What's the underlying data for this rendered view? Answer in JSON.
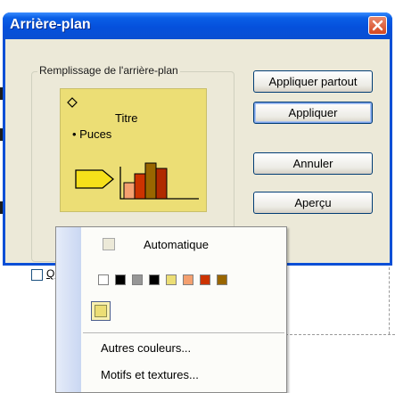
{
  "dialog": {
    "title": "Arrière-plan",
    "group_label": "Remplissage de l'arrière-plan",
    "preview": {
      "title_text": "Titre",
      "bullet_text": "Puces"
    },
    "combo": {
      "selected_color": "#ecde75"
    },
    "checkbox": {
      "label": "Q",
      "checked": false
    }
  },
  "buttons": {
    "apply_all": "Appliquer partout",
    "apply": "Appliquer",
    "cancel": "Annuler",
    "preview": "Aperçu"
  },
  "popup": {
    "automatic_label": "Automatique",
    "scheme_colors": [
      "#ffffff",
      "#000000",
      "#969696",
      "#000000",
      "#ecde75",
      "#f4a070",
      "#cc3300",
      "#996600"
    ],
    "recent_color": "#ecde75",
    "more_colors_label": "Autres couleurs...",
    "fill_effects_label": "Motifs et textures..."
  },
  "icons": {
    "close": "close-icon",
    "combo_arrow": "chevron-down-icon"
  },
  "colors": {
    "titlebar": "#0a4fd6",
    "dialog_bg": "#ece9d8",
    "preview_bg": "#ecde75"
  }
}
